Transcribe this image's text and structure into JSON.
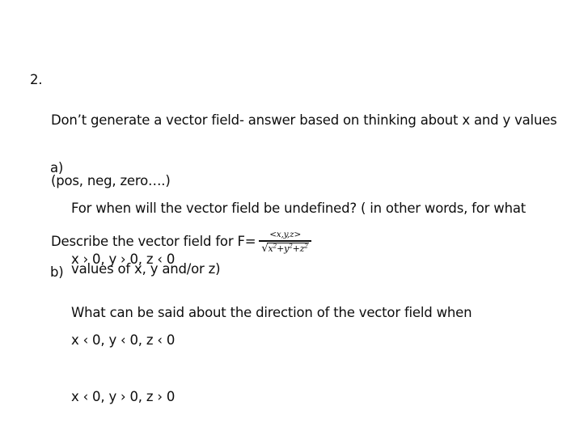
{
  "document": {
    "question": {
      "number": "2.",
      "lines": [
        "Don’t generate a vector field- answer based on thinking about x and y values",
        "(pos, neg, zero….)"
      ],
      "formula_lead": "Describe the vector field for F=",
      "formula": {
        "numerator": "<x,y,z>",
        "denominator_radicand_parts": [
          "x",
          "2",
          "+y",
          "2",
          "+z",
          "2"
        ],
        "radical_sign": "√",
        "denominator_plain": "√(x²+y²+z²)"
      }
    },
    "parts": [
      {
        "letter": "a)",
        "lines": [
          "For when will the vector field be undefined? ( in other words, for what",
          "values of x, y and/or z)"
        ]
      },
      {
        "letter": "b)",
        "lines": [
          "What can be said about the direction of the vector field when"
        ],
        "conditions": [
          "x › 0, y › 0, z ‹ 0",
          "x ‹ 0, y ‹ 0, z ‹ 0",
          "x ‹ 0, y › 0, z › 0"
        ]
      }
    ],
    "colors": {
      "background": "#ffffff",
      "text": "#0d0d0d"
    }
  }
}
